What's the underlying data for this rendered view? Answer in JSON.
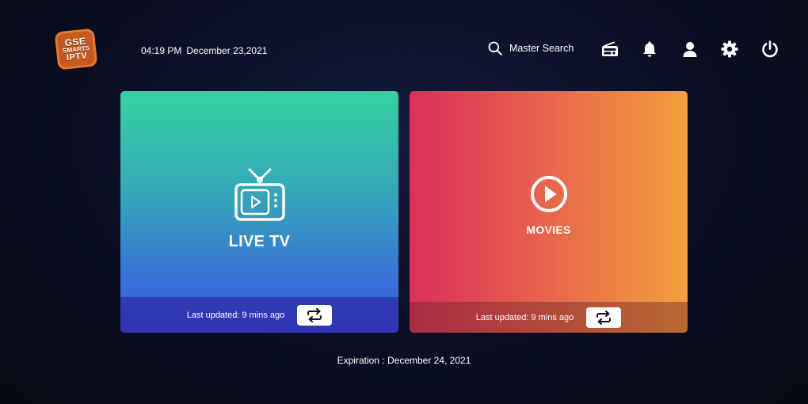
{
  "app": {
    "logo_lines": [
      "GSE",
      "SMARTS",
      "IPTV"
    ]
  },
  "header": {
    "time": "04:19 PM",
    "date": "December 23,2021",
    "search_label": "Master Search",
    "icons": [
      "search-icon",
      "radio-icon",
      "bell-icon",
      "user-icon",
      "gear-icon",
      "power-icon"
    ]
  },
  "cards": {
    "live": {
      "title": "LIVE TV",
      "last_updated": "Last updated: 9 mins ago",
      "icon": "tv-icon",
      "gradient": [
        "#33d3a0",
        "#3c4fd8"
      ]
    },
    "movies": {
      "title": "MOVIES",
      "last_updated": "Last updated: 9 mins ago",
      "icon": "play-circle-icon",
      "gradient": [
        "#dc2f5a",
        "#f3a03d"
      ]
    }
  },
  "footer": {
    "expiration": "Expiration : December 24, 2021"
  }
}
